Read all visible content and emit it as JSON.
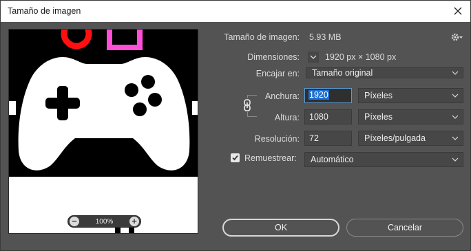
{
  "window": {
    "title": "Tamaño de imagen"
  },
  "preview": {
    "zoom": "100%"
  },
  "image_size": {
    "label": "Tamaño de imagen:",
    "value": "5.93 MB"
  },
  "dimensions": {
    "label": "Dimensiones:",
    "value": "1920 px × 1080 px"
  },
  "fit": {
    "label": "Encajar en:",
    "value": "Tamaño original"
  },
  "width": {
    "label": "Anchura:",
    "value": "1920",
    "unit": "Píxeles"
  },
  "height": {
    "label": "Altura:",
    "value": "1080",
    "unit": "Píxeles"
  },
  "resolution": {
    "label": "Resolución:",
    "value": "72",
    "unit": "Píxeles/pulgada"
  },
  "resample": {
    "label": "Remuestrear:",
    "checked": true,
    "value": "Automático"
  },
  "buttons": {
    "ok": "OK",
    "cancel": "Cancelar"
  },
  "colors": {
    "accent": "#1f6fd0",
    "bg": "#535353",
    "field": "#474747"
  }
}
